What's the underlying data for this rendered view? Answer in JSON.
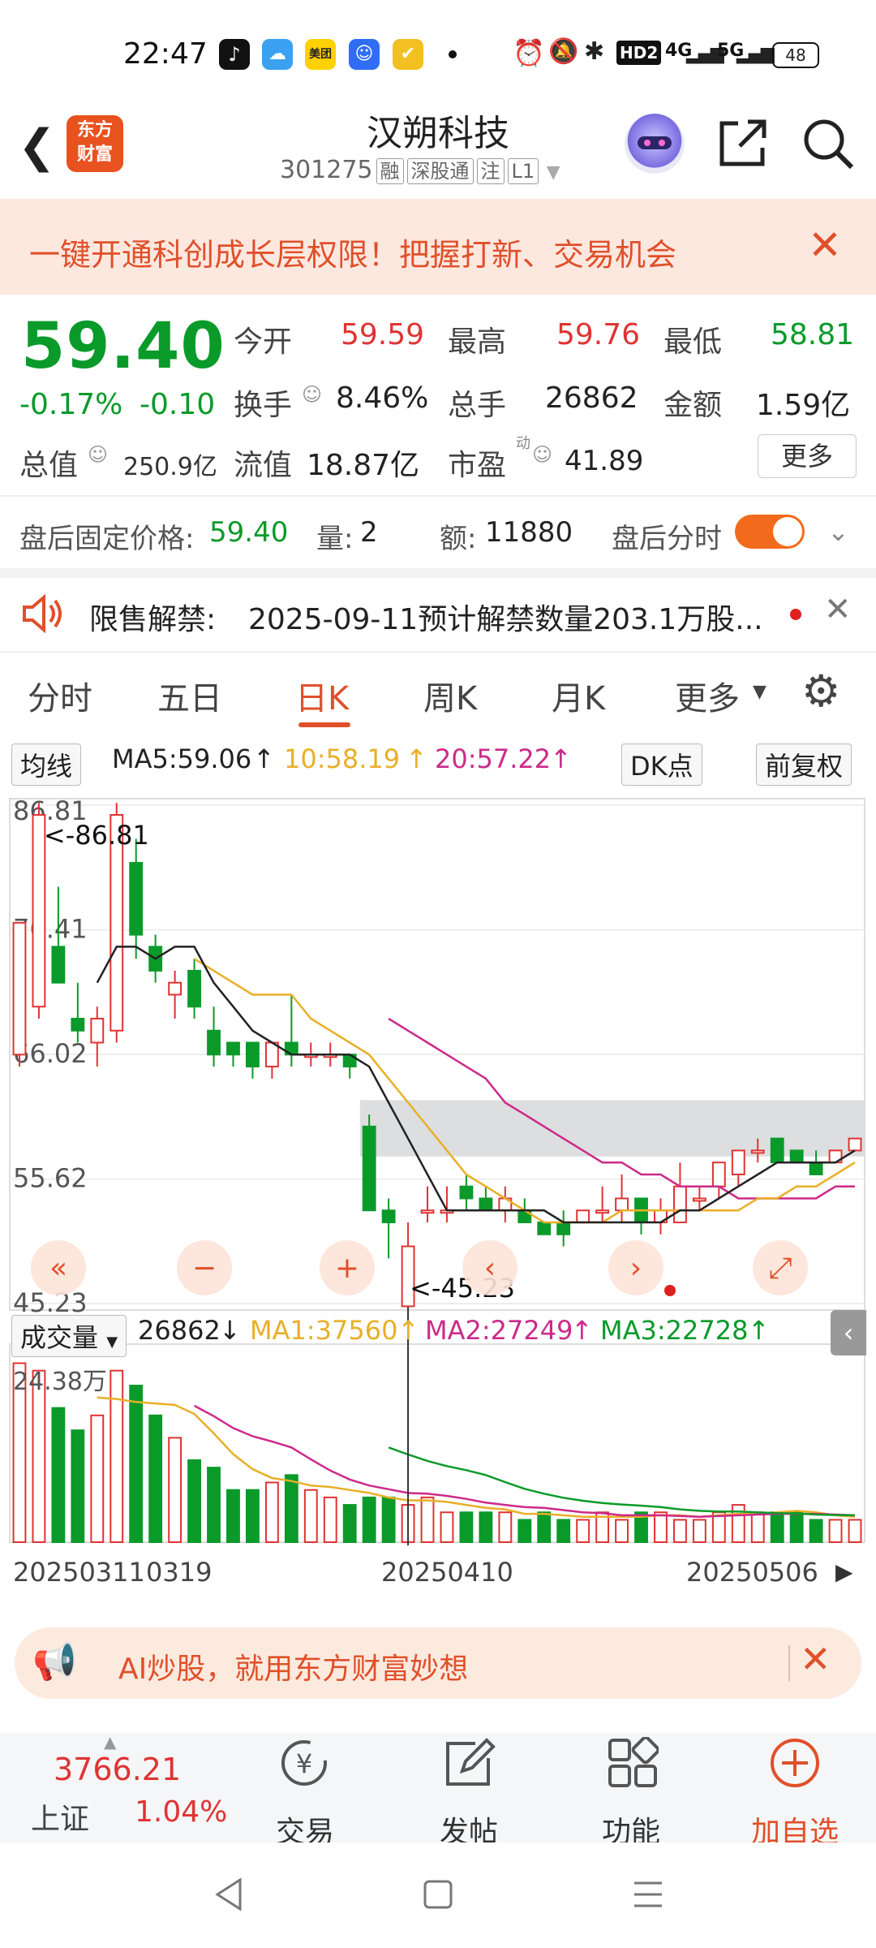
{
  "status_bar": {
    "time": "22:47",
    "network": "4G",
    "network2": "5G",
    "battery": "48",
    "hd": "HD2"
  },
  "header": {
    "back_icon": "chevron-left-icon",
    "logo_text_1": "东方",
    "logo_text_2": "财富",
    "title": "汉朔科技",
    "code": "301275",
    "tags": [
      "融",
      "深股通",
      "注",
      "L1"
    ],
    "share_icon": "share-icon",
    "search_icon": "search-icon",
    "assistant_icon": "robot-avatar-icon"
  },
  "banner": {
    "text": "一键开通科创成长层权限！把握打新、交易机会",
    "close_icon": "close-icon"
  },
  "quote": {
    "price": "59.40",
    "change_pct": "-0.17%",
    "change": "-0.10",
    "open_label": "今开",
    "open": "59.59",
    "high_label": "最高",
    "high": "59.76",
    "low_label": "最低",
    "low": "58.81",
    "turnover_label": "换手",
    "turnover": "8.46%",
    "volume_label": "总手",
    "volume": "26862",
    "amount_label": "金额",
    "amount": "1.59亿",
    "mktcap_label": "总值",
    "mktcap": "250.9亿",
    "float_label": "流值",
    "float": "18.87亿",
    "pe_label": "市盈",
    "pe_sup": "动",
    "pe": "41.89",
    "more": "更多"
  },
  "after_hours": {
    "price_label": "盘后固定价格:",
    "price": "59.40",
    "qty_label": "量:",
    "qty": "2",
    "amt_label": "额:",
    "amt": "11880",
    "timeshare_label": "盘后分时",
    "toggle_on": true
  },
  "notice": {
    "label": "限售解禁:",
    "text": "2025-09-11预计解禁数量203.1万股...",
    "speaker_icon": "speaker-icon",
    "close_icon": "close-icon"
  },
  "tabs": [
    {
      "label": "分时",
      "active": false
    },
    {
      "label": "五日",
      "active": false
    },
    {
      "label": "日K",
      "active": true
    },
    {
      "label": "周K",
      "active": false
    },
    {
      "label": "月K",
      "active": false
    },
    {
      "label": "更多",
      "active": false
    }
  ],
  "ma_legend": {
    "indicator": "均线",
    "ma5": "MA5:59.06",
    "ma10": "10:58.19",
    "ma20": "20:57.22",
    "dk_button": "DK点",
    "adjust_button": "前复权"
  },
  "volume_legend": {
    "indicator": "成交量",
    "volume": "26862",
    "ma1": "MA1:37560",
    "ma2": "MA2:27249",
    "ma3": "MA3:22728"
  },
  "colors": {
    "up": "#e03333",
    "down": "#0a9a2a",
    "ma5": "#222222",
    "ma10": "#e8b028",
    "ma20": "#cc2a8a",
    "accent": "#e0502a"
  },
  "chart_data": {
    "type": "candlestick",
    "y_ticks": [
      "86.81",
      "76.41",
      "66.02",
      "55.62",
      "45.23"
    ],
    "ylim": [
      45.23,
      86.81
    ],
    "max_marker": "<-86.81",
    "min_marker": "<-45.23",
    "volume_max_label": "24.38万",
    "x_ticks": [
      "20250311",
      "0319",
      "20250410",
      "20250506"
    ],
    "candles": [
      {
        "o": 66,
        "h": 77,
        "l": 65,
        "c": 77
      },
      {
        "o": 70,
        "h": 87,
        "l": 69,
        "c": 86
      },
      {
        "o": 75,
        "h": 80,
        "l": 72,
        "c": 72
      },
      {
        "o": 69,
        "h": 72,
        "l": 67,
        "c": 68
      },
      {
        "o": 67,
        "h": 70,
        "l": 65,
        "c": 69
      },
      {
        "o": 68,
        "h": 87,
        "l": 67,
        "c": 86
      },
      {
        "o": 82,
        "h": 84,
        "l": 74,
        "c": 76
      },
      {
        "o": 75,
        "h": 76,
        "l": 72,
        "c": 73
      },
      {
        "o": 71,
        "h": 73,
        "l": 69,
        "c": 72
      },
      {
        "o": 73,
        "h": 74,
        "l": 69,
        "c": 70
      },
      {
        "o": 68,
        "h": 70,
        "l": 65,
        "c": 66
      },
      {
        "o": 67,
        "h": 67,
        "l": 65,
        "c": 66
      },
      {
        "o": 67,
        "h": 67,
        "l": 64,
        "c": 65
      },
      {
        "o": 65,
        "h": 67,
        "l": 64,
        "c": 67
      },
      {
        "o": 67,
        "h": 71,
        "l": 65,
        "c": 66
      },
      {
        "o": 66,
        "h": 67,
        "l": 65,
        "c": 66
      },
      {
        "o": 66,
        "h": 67,
        "l": 65,
        "c": 66
      },
      {
        "o": 66,
        "h": 66,
        "l": 64,
        "c": 65
      },
      {
        "o": 60,
        "h": 61,
        "l": 53,
        "c": 53
      },
      {
        "o": 53,
        "h": 54,
        "l": 49,
        "c": 52
      },
      {
        "o": 45,
        "h": 52,
        "l": 45,
        "c": 50
      },
      {
        "o": 53,
        "h": 55,
        "l": 52,
        "c": 53
      },
      {
        "o": 53,
        "h": 55,
        "l": 52,
        "c": 53
      },
      {
        "o": 55,
        "h": 56,
        "l": 53,
        "c": 54
      },
      {
        "o": 54,
        "h": 55,
        "l": 53,
        "c": 53
      },
      {
        "o": 53,
        "h": 55,
        "l": 52,
        "c": 54
      },
      {
        "o": 53,
        "h": 54,
        "l": 52,
        "c": 52
      },
      {
        "o": 52,
        "h": 52,
        "l": 51,
        "c": 51
      },
      {
        "o": 52,
        "h": 53,
        "l": 50,
        "c": 51
      },
      {
        "o": 52,
        "h": 53,
        "l": 52,
        "c": 53
      },
      {
        "o": 53,
        "h": 55,
        "l": 52,
        "c": 53
      },
      {
        "o": 53,
        "h": 56,
        "l": 52,
        "c": 54
      },
      {
        "o": 54,
        "h": 54,
        "l": 51,
        "c": 52
      },
      {
        "o": 52,
        "h": 54,
        "l": 51,
        "c": 53
      },
      {
        "o": 52,
        "h": 57,
        "l": 52,
        "c": 55
      },
      {
        "o": 54,
        "h": 55,
        "l": 53,
        "c": 54
      },
      {
        "o": 55,
        "h": 57,
        "l": 54,
        "c": 57
      },
      {
        "o": 56,
        "h": 58,
        "l": 55,
        "c": 58
      },
      {
        "o": 58,
        "h": 59,
        "l": 57,
        "c": 58
      },
      {
        "o": 59,
        "h": 59,
        "l": 57,
        "c": 57
      },
      {
        "o": 58,
        "h": 58,
        "l": 57,
        "c": 57
      },
      {
        "o": 57,
        "h": 58,
        "l": 56,
        "c": 56
      },
      {
        "o": 57,
        "h": 58,
        "l": 57,
        "c": 58
      },
      {
        "o": 58,
        "h": 59,
        "l": 58,
        "c": 59
      }
    ],
    "ma5": [
      null,
      null,
      null,
      null,
      72,
      75,
      75,
      74,
      75,
      75,
      72,
      70,
      68,
      67,
      66,
      66,
      66,
      66,
      65,
      62,
      59,
      56,
      53,
      53,
      53,
      53,
      53,
      53,
      52,
      52,
      52,
      52,
      52,
      52,
      53,
      53,
      54,
      55,
      56,
      57,
      57,
      57,
      57,
      58
    ],
    "ma10": [
      null,
      null,
      null,
      null,
      null,
      null,
      null,
      null,
      null,
      74,
      73,
      72,
      71,
      71,
      71,
      69,
      68,
      67,
      66,
      64,
      62,
      60,
      58,
      56,
      55,
      54,
      53,
      52,
      52,
      52,
      52,
      53,
      53,
      53,
      53,
      53,
      53,
      53,
      54,
      54,
      55,
      55,
      56,
      57
    ],
    "ma20": [
      null,
      null,
      null,
      null,
      null,
      null,
      null,
      null,
      null,
      null,
      null,
      null,
      null,
      null,
      null,
      null,
      null,
      null,
      null,
      69,
      68,
      67,
      66,
      65,
      64,
      62,
      61,
      60,
      59,
      58,
      57,
      57,
      56,
      56,
      55,
      55,
      55,
      54,
      54,
      54,
      54,
      54,
      55,
      55
    ],
    "volumes": [
      24,
      23,
      18,
      15,
      17,
      23,
      21,
      17,
      14,
      11,
      10,
      7,
      7,
      8,
      9,
      7,
      6,
      5,
      6,
      6,
      5,
      6,
      4,
      4,
      4,
      4,
      3,
      4,
      3,
      3,
      4,
      3,
      4,
      4,
      3,
      3,
      4,
      5,
      4,
      4,
      4,
      3,
      3,
      3
    ],
    "vol_max": 24.38,
    "resistance_band": [
      57.5,
      62.2
    ]
  },
  "chart_controls": [
    "rewind-icon",
    "zoom-out-icon",
    "zoom-in-icon",
    "prev-icon",
    "next-icon",
    "fullscreen-icon"
  ],
  "ad_strip": {
    "text": "AI炒股，就用东方财富妙想",
    "icon": "megaphone-icon",
    "close_icon": "close-icon"
  },
  "bottom_nav": {
    "index_value": "3766.21",
    "index_name": "上证",
    "index_change": "1.04%",
    "items": [
      {
        "label": "交易",
        "icon": "yen-swap-icon"
      },
      {
        "label": "发帖",
        "icon": "edit-icon"
      },
      {
        "label": "功能",
        "icon": "grid-icon"
      },
      {
        "label": "加自选",
        "icon": "add-circle-icon"
      }
    ]
  }
}
